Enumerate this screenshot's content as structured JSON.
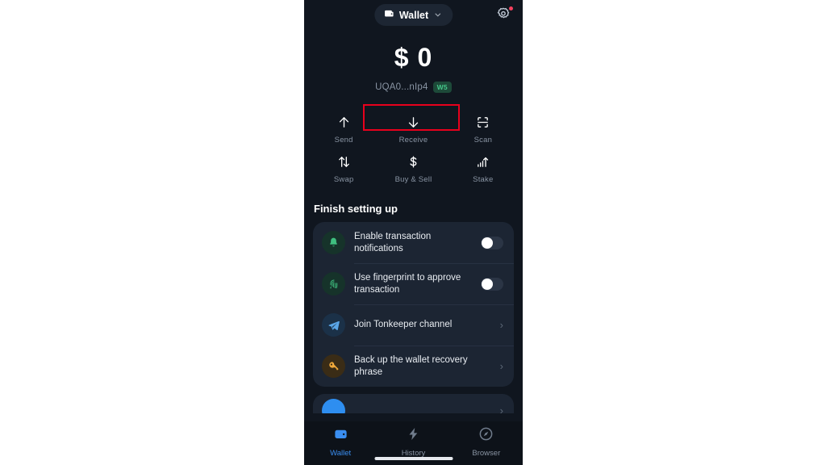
{
  "header": {
    "wallet_pill_label": "Wallet",
    "wallet_icon": "wallet-icon",
    "chevron_icon": "chevron-down-icon",
    "settings_icon": "gear-icon",
    "settings_badge": "notification-dot"
  },
  "balance": {
    "amount": "$ 0",
    "address": "UQA0...nIp4",
    "version_badge": "W5"
  },
  "annotation": {
    "color": "#e8001c",
    "target": "address-chip"
  },
  "actions": [
    {
      "label": "Send",
      "icon": "arrow-up-icon"
    },
    {
      "label": "Receive",
      "icon": "arrow-down-icon"
    },
    {
      "label": "Scan",
      "icon": "scan-viewfinder-icon"
    },
    {
      "label": "Swap",
      "icon": "swap-arrows-icon"
    },
    {
      "label": "Buy & Sell",
      "icon": "dollar-sign-icon"
    },
    {
      "label": "Stake",
      "icon": "stake-chart-arrow-icon"
    }
  ],
  "setup": {
    "title": "Finish setting up",
    "items": [
      {
        "label": "Enable transaction notifications",
        "icon": "bell-icon",
        "icon_color": "#3fbf7f",
        "icon_bg": "#16332a",
        "control": "toggle",
        "toggle_on": false
      },
      {
        "label": "Use fingerprint to approve transaction",
        "icon": "fingerprint-icon",
        "icon_color": "#3fbf7f",
        "icon_bg": "#16332a",
        "control": "toggle",
        "toggle_on": false
      },
      {
        "label": "Join Tonkeeper channel",
        "icon": "telegram-icon",
        "icon_color": "#4b9ae0",
        "icon_bg": "#1b3148",
        "control": "chevron",
        "chevron": "›"
      },
      {
        "label": "Back up the wallet recovery phrase",
        "icon": "key-icon",
        "icon_color": "#f0a93b",
        "icon_bg": "#3a2c16",
        "control": "chevron",
        "chevron": "›"
      }
    ],
    "partial_item": {
      "label": "",
      "icon": "blue-circle-icon",
      "icon_color": "#2e8ef0"
    }
  },
  "bottom_nav": {
    "items": [
      {
        "label": "Wallet",
        "icon": "wallet-icon",
        "active": true
      },
      {
        "label": "History",
        "icon": "lightning-icon",
        "active": false
      },
      {
        "label": "Browser",
        "icon": "compass-icon",
        "active": false
      }
    ],
    "home_indicator": "home-indicator"
  },
  "colors": {
    "page_bg": "#ffffff",
    "app_bg": "#10161f",
    "card_bg": "#1c2533",
    "accent_blue": "#3a8ef0",
    "muted_text": "#8994a3",
    "annotation_red": "#e8001c",
    "badge_green": "#45c78a"
  }
}
